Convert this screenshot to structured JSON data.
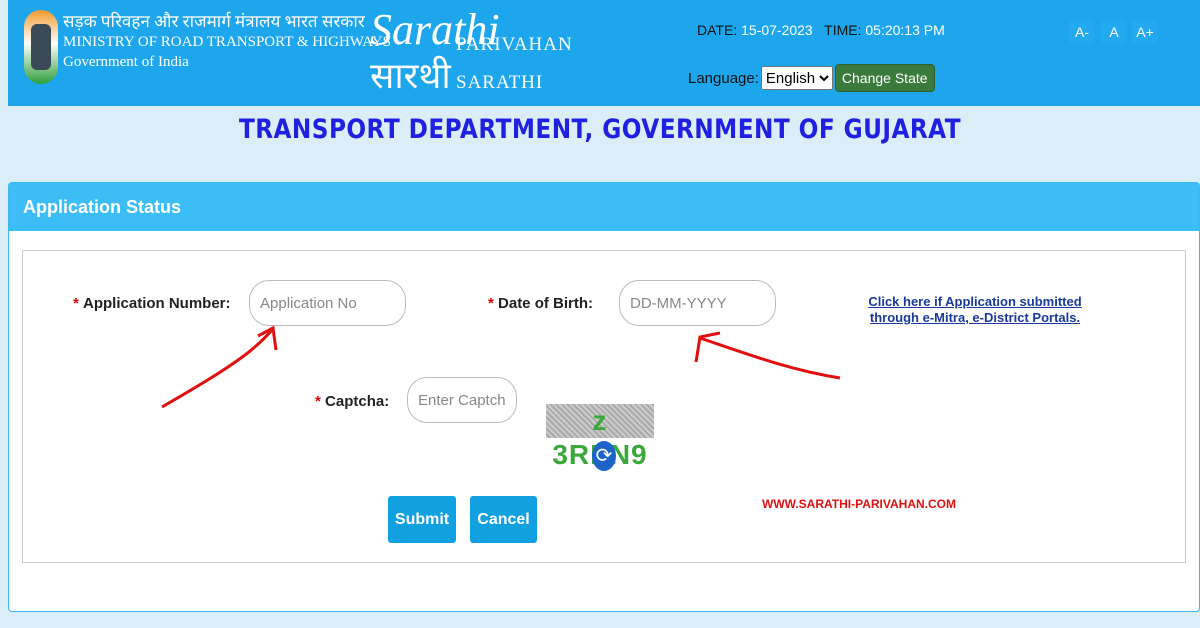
{
  "header": {
    "ministry_hindi": "सड़क परिवहन और राजमार्ग मंत्रालय भारत सरकार",
    "ministry_english": "MINISTRY OF ROAD TRANSPORT & HIGHWAYS",
    "government": "Government of India",
    "logo_text": "Sarathi",
    "logo_hindi": "सारथी",
    "brand_line1": "PARIVAHAN",
    "brand_line2": "SARATHI",
    "date_label": "DATE:",
    "date": "15-07-2023",
    "time_label": "TIME:",
    "time": "05:20:13 PM",
    "language_label": "Language:",
    "language_selected": "English",
    "change_state": "Change State",
    "font_small": "A-",
    "font_normal": "A",
    "font_large": "A+"
  },
  "page_title": "TRANSPORT DEPARTMENT, GOVERNMENT OF GUJARAT",
  "panel": {
    "title": "Application Status",
    "required_mark": "*",
    "app_no_label": "Application Number:",
    "app_no_placeholder": "Application No",
    "dob_label": "Date of Birth:",
    "dob_placeholder": "DD-MM-YYYY",
    "captcha_label": "Captcha:",
    "captcha_placeholder": "Enter Captcha Here",
    "captcha_text": "z 3REN9",
    "link_line1": "Click here if Application submitted",
    "link_line2": "through e-Mitra, e-District Portals.",
    "submit": "Submit",
    "cancel": "Cancel",
    "watermark": "WWW.SARATHI-PARIVAHAN.COM"
  },
  "colors": {
    "header_bg": "#1da6ec",
    "title": "#2020e0",
    "button": "#12a1e0",
    "annotation_arrow": "#e01010"
  }
}
